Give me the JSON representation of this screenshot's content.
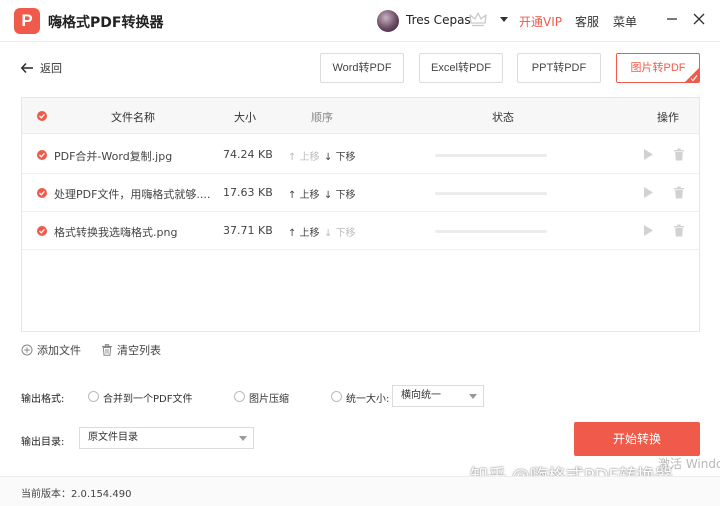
{
  "app": {
    "title": "嗨格式PDF转换器",
    "logo_glyph": "P"
  },
  "user": {
    "name": "Tres Cepas"
  },
  "header": {
    "vip_label": "开通VIP",
    "service_label": "客服",
    "menu_label": "菜单"
  },
  "nav": {
    "back_label": "返回"
  },
  "format_tabs": [
    {
      "label": "Word转PDF",
      "active": false
    },
    {
      "label": "Excel转PDF",
      "active": false
    },
    {
      "label": "PPT转PDF",
      "active": false
    },
    {
      "label": "图片转PDF",
      "active": true
    }
  ],
  "table": {
    "headers": {
      "name": "文件名称",
      "size": "大小",
      "order": "顺序",
      "status": "状态",
      "action": "操作"
    },
    "move_up_label": "上移",
    "move_down_label": "下移",
    "rows": [
      {
        "name": "PDF合并-Word复制.jpg",
        "size": "74.24 KB",
        "up_enabled": false,
        "down_enabled": true,
        "progress": 0
      },
      {
        "name": "处理PDF文件，用嗨格式就够....",
        "size": "17.63 KB",
        "up_enabled": true,
        "down_enabled": true,
        "progress": 0
      },
      {
        "name": "格式转换我选嗨格式.png",
        "size": "37.71 KB",
        "up_enabled": true,
        "down_enabled": false,
        "progress": 0
      }
    ]
  },
  "list_actions": {
    "add_label": "添加文件",
    "clear_label": "清空列表"
  },
  "output": {
    "format_label": "输出格式:",
    "options": {
      "merge": "合并到一个PDF文件",
      "compress": "图片压缩",
      "unify": "统一大小:"
    },
    "unify_select": "横向统一",
    "dir_label": "输出目录:",
    "dir_select": "原文件目录"
  },
  "start_label": "开始转换",
  "watermark": "知乎 @嗨格式PDF转换器",
  "windows_activate": "激活 Windows",
  "version": "当前版本：2.0.154.490",
  "colors": {
    "accent": "#f05a4a"
  }
}
